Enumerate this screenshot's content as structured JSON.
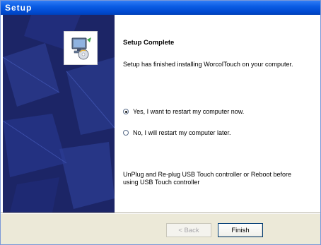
{
  "window": {
    "title": "Setup"
  },
  "sidebar": {
    "icon": "setup-installer-icon"
  },
  "content": {
    "heading": "Setup Complete",
    "description": "Setup has finished installing WorcolTouch on your computer.",
    "options": [
      {
        "label": "Yes, I want to restart my computer now.",
        "selected": true
      },
      {
        "label": "No, I will restart my computer later.",
        "selected": false
      }
    ],
    "note_line1": "UnPlug and Re-plug USB Touch controller or Reboot before",
    "note_line2": "using USB Touch controller"
  },
  "footer": {
    "back_label": "< Back",
    "finish_label": "Finish"
  },
  "colors": {
    "title_bar": "#0a5ce4",
    "sidebar": "#1c2566",
    "dialog_face": "#ece9d8"
  }
}
